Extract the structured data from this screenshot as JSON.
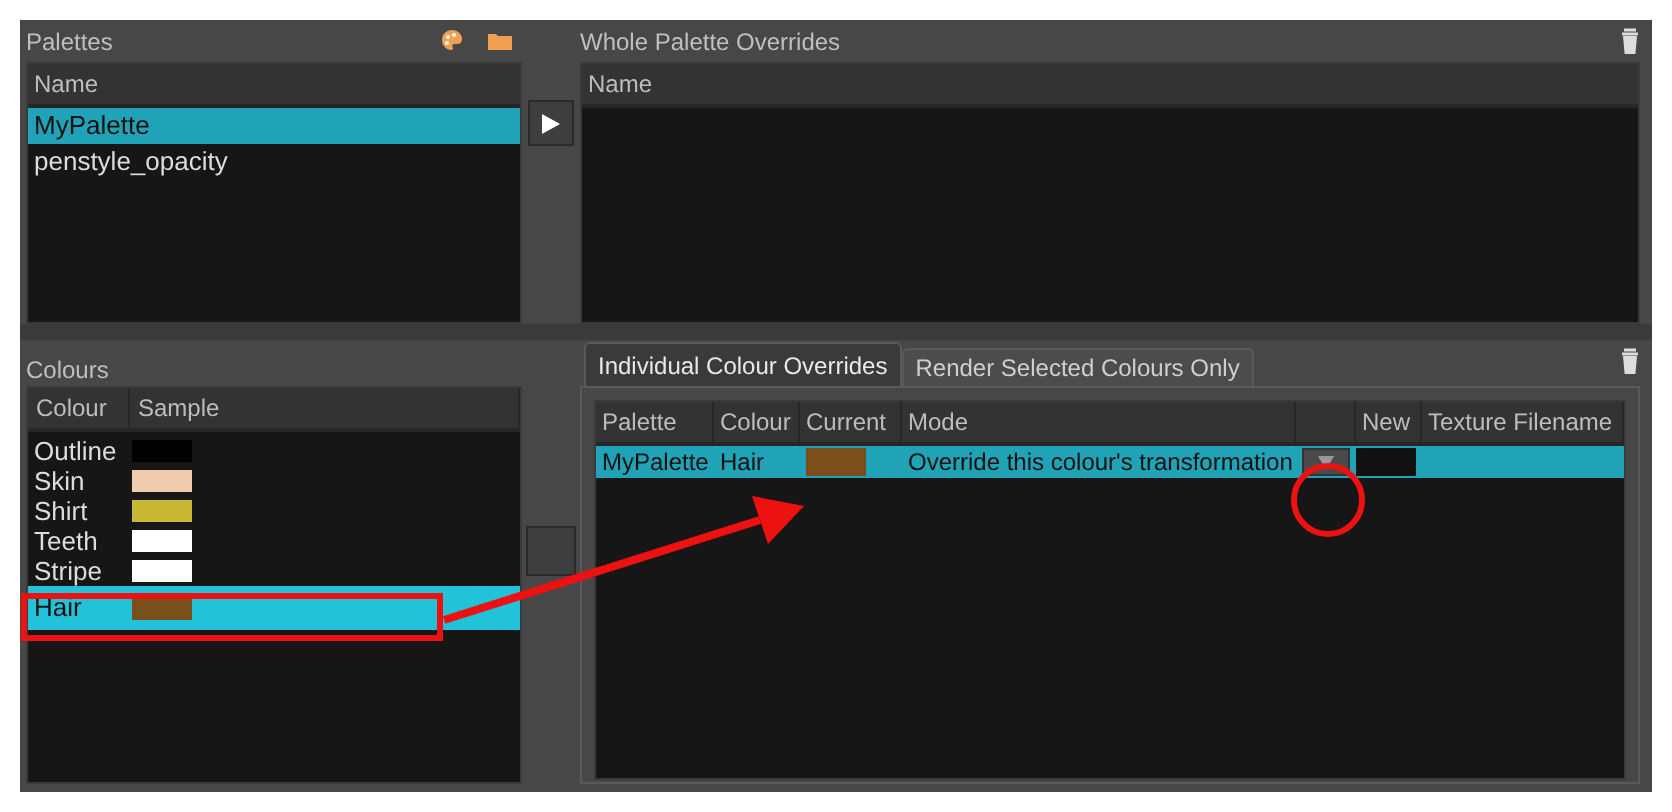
{
  "palettes": {
    "title": "Palettes",
    "column": "Name",
    "items": [
      {
        "label": "MyPalette",
        "selected": true
      },
      {
        "label": "penstyle_opacity",
        "selected": false
      }
    ]
  },
  "whole_palette_overrides": {
    "title": "Whole Palette Overrides",
    "column": "Name"
  },
  "colours": {
    "title": "Colours",
    "columns": [
      "Colour",
      "Sample"
    ],
    "items": [
      {
        "label": "Outline",
        "color": "#000000",
        "selected": false
      },
      {
        "label": "Skin",
        "color": "#f1cbad",
        "selected": false
      },
      {
        "label": "Shirt",
        "color": "#c6b833",
        "selected": false
      },
      {
        "label": "Teeth",
        "color": "#ffffff",
        "selected": false
      },
      {
        "label": "Stripe",
        "color": "#ffffff",
        "selected": false
      },
      {
        "label": "Hair",
        "color": "#7a4f1c",
        "selected": true
      }
    ]
  },
  "tabs": [
    {
      "label": "Individual Colour Overrides",
      "selected": true
    },
    {
      "label": "Render Selected Colours Only",
      "selected": false
    }
  ],
  "overrides_table": {
    "columns": [
      "Palette",
      "Colour",
      "Current",
      "Mode",
      "",
      "New",
      "Texture Filename"
    ],
    "rows": [
      {
        "palette": "MyPalette",
        "colour": "Hair",
        "current": {
          "color": "#7a4f1c"
        },
        "mode": "Override this colour's transformation",
        "new": {
          "color": "#111111"
        },
        "selected": true
      }
    ]
  },
  "annotations": [
    {
      "kind": "box"
    },
    {
      "kind": "arrow"
    },
    {
      "kind": "circle"
    }
  ]
}
